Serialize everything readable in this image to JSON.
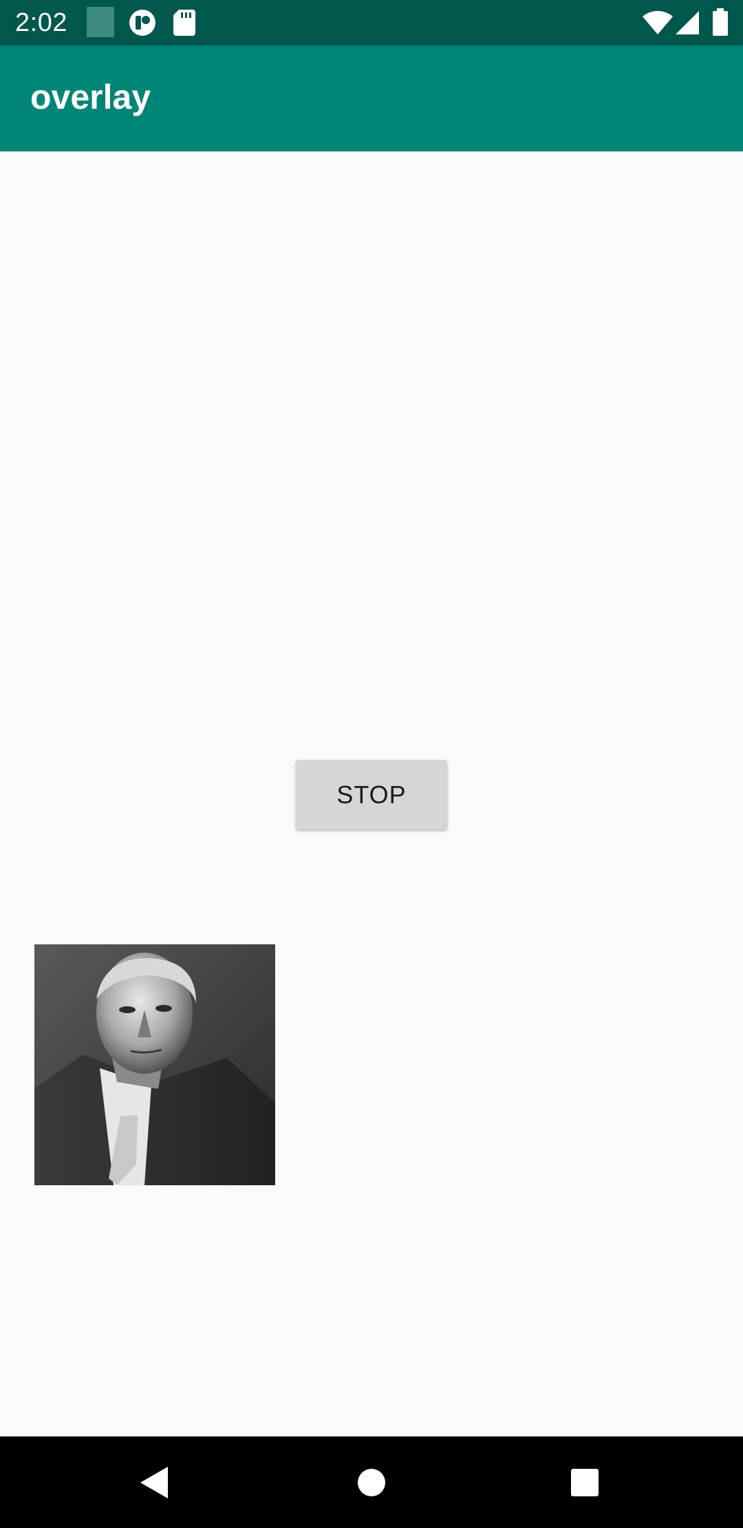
{
  "status_bar": {
    "time": "2:02",
    "icons": [
      "app-square-icon",
      "notification-circle-icon",
      "sd-card-icon",
      "wifi-icon",
      "signal-icon",
      "battery-icon"
    ]
  },
  "app_bar": {
    "title": "overlay"
  },
  "main": {
    "stop_button_label": "STOP",
    "photo": "portrait-photo-elderly-man"
  },
  "nav_bar": {
    "icons": [
      "back-icon",
      "home-icon",
      "recents-icon"
    ]
  },
  "colors": {
    "status_bar": "#00574b",
    "app_bar": "#008577",
    "background": "#fafafa",
    "button": "#d6d6d6",
    "nav_bar": "#000000"
  }
}
